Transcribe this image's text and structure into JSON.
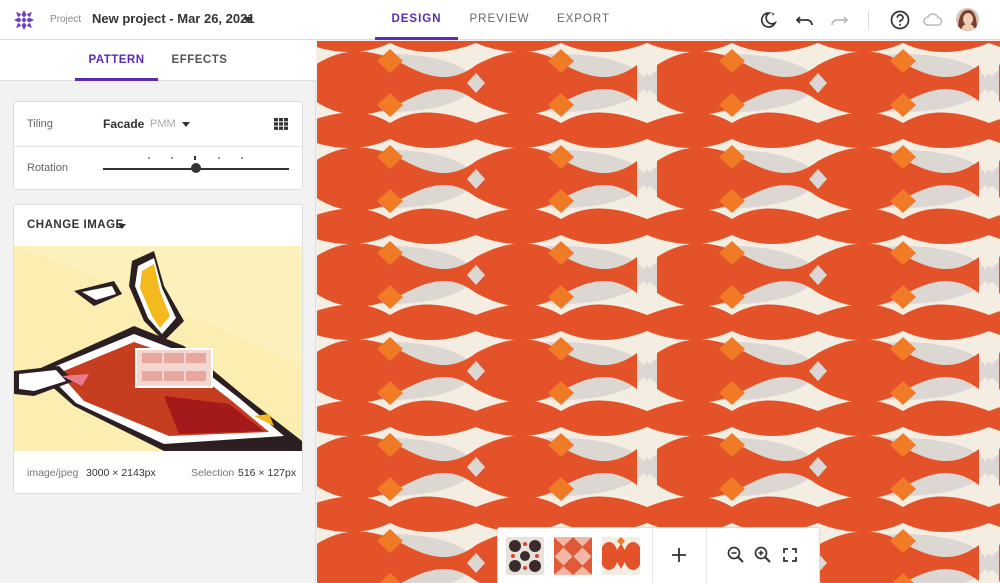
{
  "app": {
    "project_label": "Project",
    "project_name": "New project - Mar 26, 2021"
  },
  "top_tabs": [
    {
      "label": "DESIGN",
      "active": true
    },
    {
      "label": "PREVIEW",
      "active": false
    },
    {
      "label": "EXPORT",
      "active": false
    }
  ],
  "top_icons": [
    "theme-toggle-icon",
    "undo-icon",
    "redo-icon",
    "help-icon",
    "cloud-icon"
  ],
  "side_tabs": [
    {
      "label": "PATTERN",
      "active": true
    },
    {
      "label": "EFFECTS",
      "active": false
    }
  ],
  "tiling": {
    "label": "Tiling",
    "value": "Facade",
    "sub": "PMM"
  },
  "rotation": {
    "label": "Rotation",
    "ticks": 5,
    "selected_tick": 2
  },
  "image_panel": {
    "change_label": "CHANGE IMAGE",
    "mime": "image/jpeg",
    "dimensions": "3000 × 2143px",
    "selection_label": "Selection",
    "selection_value": "516 × 127px"
  },
  "toolbar": {
    "thumbnails": [
      "pattern-thumb-1",
      "pattern-thumb-2",
      "pattern-thumb-3"
    ],
    "icons": [
      "add-icon",
      "zoom-out-icon",
      "zoom-in-icon",
      "fullscreen-icon"
    ]
  },
  "colors": {
    "accent": "#5b2bb7",
    "pattern_red": "#e0502a",
    "pattern_orange": "#f07a26",
    "pattern_grey": "#dcd7d3",
    "pattern_cream": "#f5efe4"
  }
}
